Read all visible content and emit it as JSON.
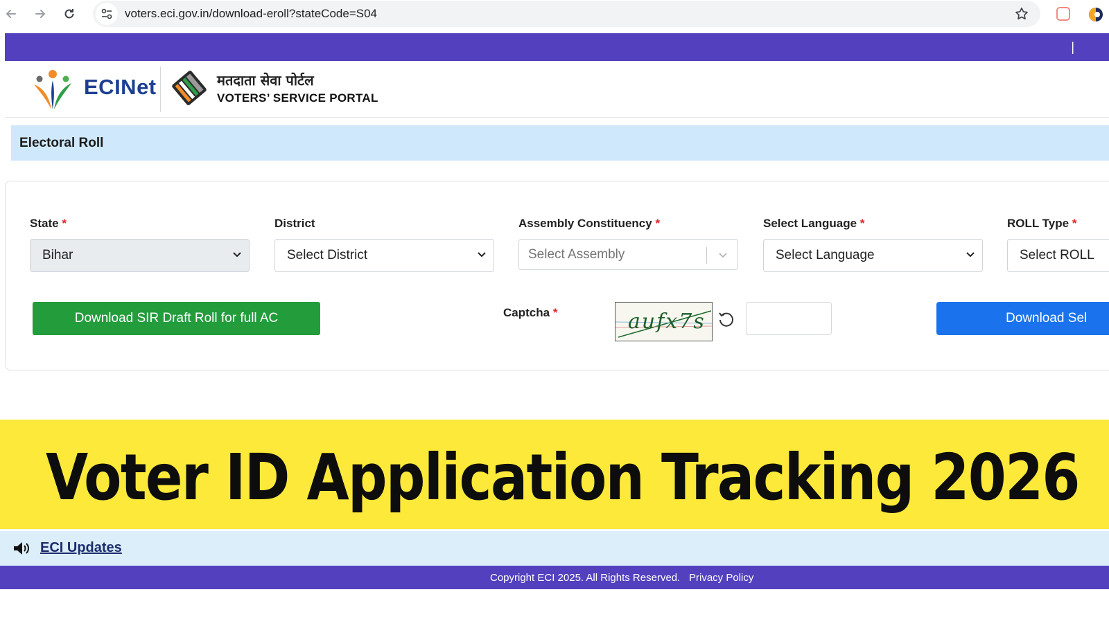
{
  "browser": {
    "url": "voters.eci.gov.in/download-eroll?stateCode=S04"
  },
  "header": {
    "brand": "ECINet",
    "hindi_title": "मतदाता सेवा पोर्टल",
    "portal_title": "VOTERS’ SERVICE PORTAL",
    "top_band_separator": "|"
  },
  "section": {
    "title": "Electoral Roll"
  },
  "form": {
    "state": {
      "label": "State",
      "required": "*",
      "value": "Bihar"
    },
    "district": {
      "label": "District",
      "value": "Select District"
    },
    "assembly": {
      "label": "Assembly Constituency",
      "required": "*",
      "placeholder": "Select Assembly"
    },
    "language": {
      "label": "Select Language",
      "required": "*",
      "value": "Select Language"
    },
    "roll_type": {
      "label": "ROLL Type",
      "required": "*",
      "value": "Select ROLL"
    },
    "download_full_label": "Download SIR Draft Roll for full AC",
    "captcha": {
      "label": "Captcha",
      "required": "*",
      "image_text": "aufx7s",
      "input_value": ""
    },
    "download_selected_label": "Download Sel"
  },
  "banner": {
    "headline": "Voter ID Application Tracking 2026"
  },
  "updates": {
    "link_label": "ECI Updates"
  },
  "footer": {
    "copyright": "Copyright ECI 2025. All Rights Reserved.",
    "privacy": "Privacy Policy"
  },
  "colors": {
    "brand_purple": "#5340be",
    "section_blue": "#cfe8fb",
    "green_button": "#239c3c",
    "blue_button": "#1a73ec",
    "banner_yellow": "#fde93a"
  }
}
